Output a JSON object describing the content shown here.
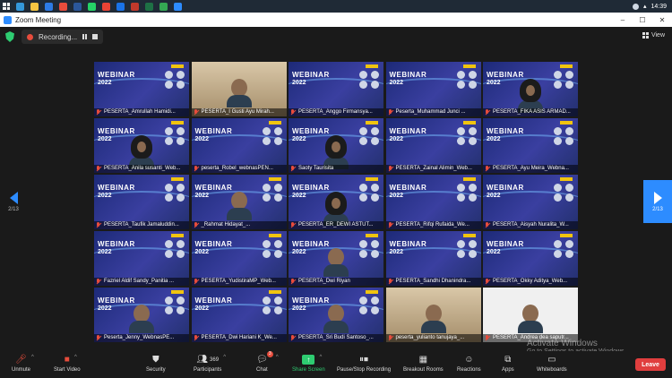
{
  "app": {
    "title": "Zoom Meeting"
  },
  "windows_controls": {
    "minimize": "–",
    "maximize": "☐",
    "close": "✕"
  },
  "taskbar": {
    "time": "14:39",
    "icon_colors": [
      "#3498db",
      "#f5c542",
      "#2d7be5",
      "#e74c3c",
      "#2b579a",
      "#25d366",
      "#ea4335",
      "#1a73e8",
      "#c0392b",
      "#1e7145",
      "#34a853",
      "#2d8cff"
    ]
  },
  "recording": {
    "label": "Recording..."
  },
  "view": {
    "label": "View"
  },
  "slide": {
    "title": "WEBINAR",
    "subtitle": "2022"
  },
  "pagination": {
    "prev": "2/13",
    "next": "2/13"
  },
  "participants": [
    {
      "name": "PESERTA_Amrullah Hamidi...",
      "type": "slide"
    },
    {
      "name": "PESERTA_I Gusti Ayu Mirah...",
      "type": "cam-light"
    },
    {
      "name": "PESERTA_Anggo Firmansya...",
      "type": "slide"
    },
    {
      "name": "Peserta_Muhammad Junci ...",
      "type": "slide"
    },
    {
      "name": "PESERTA_FIKA ASIS ARMAD...",
      "type": "slide-hijab"
    },
    {
      "name": "PESERTA_Anila susanti_Web...",
      "type": "slide-hijab"
    },
    {
      "name": "peserta_Robel_webnasPEN...",
      "type": "slide"
    },
    {
      "name": "Saoty Taurisita",
      "type": "slide-hijab"
    },
    {
      "name": "PESERTA_Zainal Alimin_Web...",
      "type": "slide"
    },
    {
      "name": "PESERTA_Ayu Meira_Webna...",
      "type": "slide"
    },
    {
      "name": "PESERTA_Taufik Jamaluddin...",
      "type": "slide"
    },
    {
      "name": "_Rahmat Hidayat_...",
      "type": "slide-person"
    },
    {
      "name": "PESERTA_ER_DEWI ASTUT...",
      "type": "slide-hijab"
    },
    {
      "name": "PESERTA_Rifqi Rufaida_We...",
      "type": "slide"
    },
    {
      "name": "PESERTA_Aisyah Nuralita_W...",
      "type": "slide"
    },
    {
      "name": "Fazriel Aldif Sandy_Panitia ...",
      "type": "slide"
    },
    {
      "name": "PESERTA_YudistiraMP_Web...",
      "type": "slide"
    },
    {
      "name": "PESERTA_Dwi Riyan",
      "type": "slide-person"
    },
    {
      "name": "PESERTA_Sandhi Dhanindra...",
      "type": "slide"
    },
    {
      "name": "PESERTA_Okky Aditya_Web...",
      "type": "slide"
    },
    {
      "name": "Peserta_Jenny_WebnasPE...",
      "type": "slide-person"
    },
    {
      "name": "PESERTA_Dwi Hariani K_We...",
      "type": "slide"
    },
    {
      "name": "PESERTA_Sri Budi Santoso_...",
      "type": "slide-person"
    },
    {
      "name": "peserta_yulianto tanujaya_...",
      "type": "cam-light"
    },
    {
      "name": "PESERTA_Andrea dea saputr...",
      "type": "cam-white"
    }
  ],
  "toolbar": {
    "unmute": "Unmute",
    "start_video": "Start Video",
    "security": "Security",
    "participants": "Participants",
    "participants_count": "369",
    "chat": "Chat",
    "chat_count": "3",
    "share_screen": "Share Screen",
    "record": "Pause/Stop Recording",
    "breakout": "Breakout Rooms",
    "reactions": "Reactions",
    "apps": "Apps",
    "whiteboards": "Whiteboards",
    "leave": "Leave"
  },
  "watermark": {
    "line1": "Activate Windows",
    "line2": "Go to Settings to activate Windows."
  }
}
